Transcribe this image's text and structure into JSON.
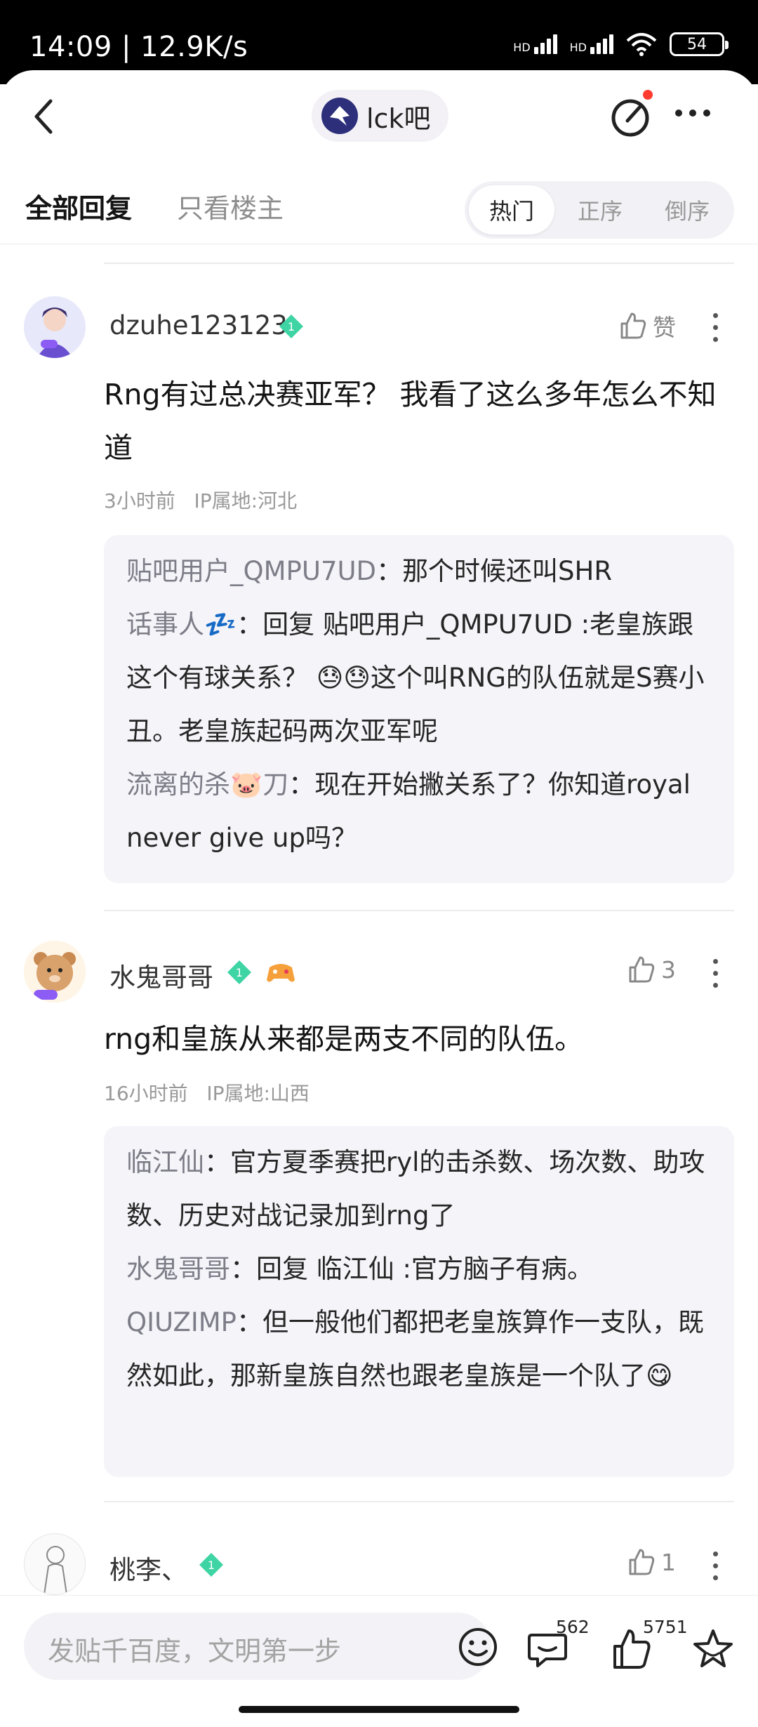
{
  "status_bar": {
    "time": "14:09 | 12.9K/s",
    "network_1": "HD",
    "network_2": "HD",
    "battery": "54"
  },
  "header": {
    "forum_name": "lck吧"
  },
  "tabs": {
    "all_replies": "全部回复",
    "op_only": "只看楼主"
  },
  "sort": {
    "hot": "热门",
    "asc": "正序",
    "desc": "倒序"
  },
  "comments": [
    {
      "username": "dzuhe123123",
      "level": "1",
      "like_label": "赞",
      "text": "Rng有过总决赛亚军？ 我看了这么多年怎么不知道",
      "time": "3小时前",
      "location": "IP属地:河北",
      "replies": [
        {
          "who": "贴吧用户_QMPU7UD",
          "text": "那个时候还叫SHR"
        },
        {
          "who": "话事人💤",
          "text": "回复 贴吧用户_QMPU7UD :老皇族跟这个有球关系？ 😓😓这个叫RNG的队伍就是S赛小丑。老皇族起码两次亚军呢"
        },
        {
          "who": "流离的杀🐷刀",
          "text": "现在开始撇关系了？你知道royal never give up吗？"
        }
      ]
    },
    {
      "username": "水鬼哥哥",
      "level": "1",
      "like_count": "3",
      "text": "rng和皇族从来都是两支不同的队伍。",
      "time": "16小时前",
      "location": "IP属地:山西",
      "replies": [
        {
          "who": "临江仙",
          "text": "官方夏季赛把ryl的击杀数、场次数、助攻数、历史对战记录加到rng了"
        },
        {
          "who": "水鬼哥哥",
          "text": "回复 临江仙 :官方脑子有病。"
        },
        {
          "who": "QIUZIMP",
          "text": "但一般他们都把老皇族算作一支队，既然如此，那新皇族自然也跟老皇族是一个队了😋"
        }
      ]
    },
    {
      "username": "桃李、",
      "level": "1",
      "like_count": "1"
    }
  ],
  "bottom_bar": {
    "input_placeholder": "发贴千百度，文明第一步",
    "comment_count": "562",
    "like_count": "5751"
  },
  "colors": {
    "reply_name": "#7d7d88",
    "reply_bg": "#f5f4f9",
    "level_badge": "#3fd4a4",
    "notif_dot": "#ff3b30"
  }
}
